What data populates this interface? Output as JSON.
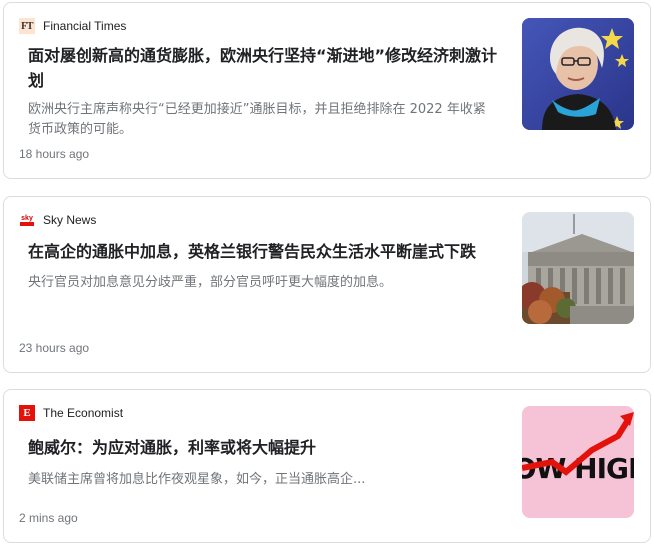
{
  "articles": [
    {
      "source": "Financial Times",
      "logo_text": "FT",
      "headline": "面对屡创新高的通货膨胀，欧洲央行坚持“渐进地”修改经济刺激计划",
      "snippet": "欧洲央行主席声称央行“已经更加接近”通胀目标，并且拒绝排除在 2022 年收紧货币政策的可能。",
      "time": "18 hours ago",
      "thumbnail": "portrait-photo"
    },
    {
      "source": "Sky News",
      "logo_text": "sky",
      "headline": "在高企的通胀中加息，英格兰银行警告民众生活水平断崖式下跌",
      "snippet": "央行官员对加息意见分歧严重，部分官员呼吁更大幅度的加息。",
      "time": "23 hours ago",
      "thumbnail": "building-photo"
    },
    {
      "source": "The Economist",
      "logo_text": "E",
      "headline": "鲍威尔：为应对通胀，利率或将大幅提升",
      "snippet": "美联储主席曾将加息比作夜观星象，如今，正当通胀高企...",
      "time": "2 mins ago",
      "thumbnail": "how-high-graphic",
      "thumb_text": "HOW HIGH?"
    }
  ],
  "colors": {
    "ft_logo_bg": "#fce4d1",
    "sky_red": "#e3120b",
    "economist_red": "#e3120b",
    "graphic_pink": "#f6c3d6"
  }
}
